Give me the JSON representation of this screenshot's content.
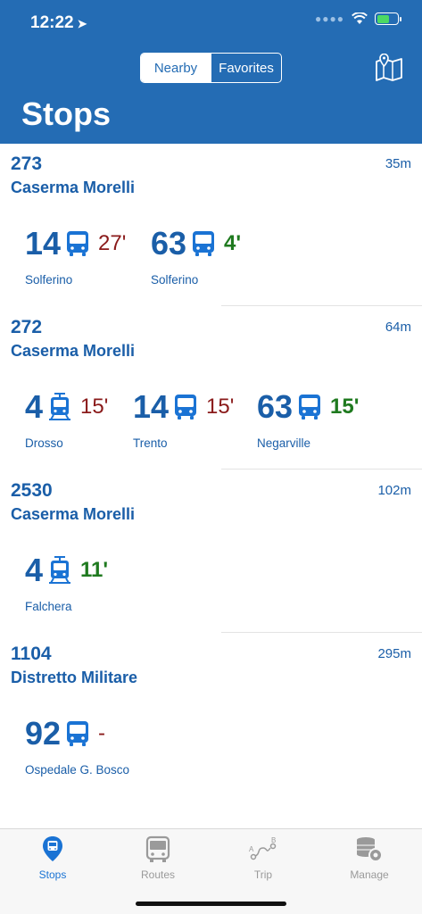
{
  "status": {
    "time": "12:22",
    "location_icon": "location-arrow-icon"
  },
  "header": {
    "segments": [
      "Nearby",
      "Favorites"
    ],
    "selected_segment": "Nearby",
    "map_icon": "map-icon",
    "title": "Stops"
  },
  "stops": [
    {
      "number": "273",
      "distance": "35m",
      "name": "Caserma Morelli",
      "lines": [
        {
          "number": "14",
          "vehicle": "bus",
          "minutes": "27'",
          "minutes_color": "#8a1a1a",
          "destination": "Solferino"
        },
        {
          "number": "63",
          "vehicle": "bus",
          "minutes": "4'",
          "minutes_color": "#1f7a1f",
          "destination": "Solferino"
        }
      ]
    },
    {
      "number": "272",
      "distance": "64m",
      "name": "Caserma Morelli",
      "lines": [
        {
          "number": "4",
          "vehicle": "tram",
          "minutes": "15'",
          "minutes_color": "#8a1a1a",
          "destination": "Drosso"
        },
        {
          "number": "14",
          "vehicle": "bus",
          "minutes": "15'",
          "minutes_color": "#8a1a1a",
          "destination": "Trento"
        },
        {
          "number": "63",
          "vehicle": "bus",
          "minutes": "15'",
          "minutes_color": "#1f7a1f",
          "destination": "Negarville"
        }
      ]
    },
    {
      "number": "2530",
      "distance": "102m",
      "name": "Caserma Morelli",
      "lines": [
        {
          "number": "4",
          "vehicle": "tram",
          "minutes": "11'",
          "minutes_color": "#1f7a1f",
          "destination": "Falchera"
        }
      ]
    },
    {
      "number": "1104",
      "distance": "295m",
      "name": "Distretto Militare",
      "lines": [
        {
          "number": "92",
          "vehicle": "bus",
          "minutes": "-",
          "minutes_color": "#8a1a1a",
          "destination": "Ospedale G. Bosco"
        }
      ]
    }
  ],
  "tabbar": {
    "items": [
      {
        "label": "Stops",
        "icon": "bus-stop-pin-icon",
        "active": true
      },
      {
        "label": "Routes",
        "icon": "bus-front-icon",
        "active": false
      },
      {
        "label": "Trip",
        "icon": "route-a-b-icon",
        "active": false
      },
      {
        "label": "Manage",
        "icon": "database-gear-icon",
        "active": false
      }
    ]
  },
  "colors": {
    "header_bg": "#246cb4",
    "text_blue": "#1a5ea8",
    "tab_active": "#1a73d4"
  }
}
